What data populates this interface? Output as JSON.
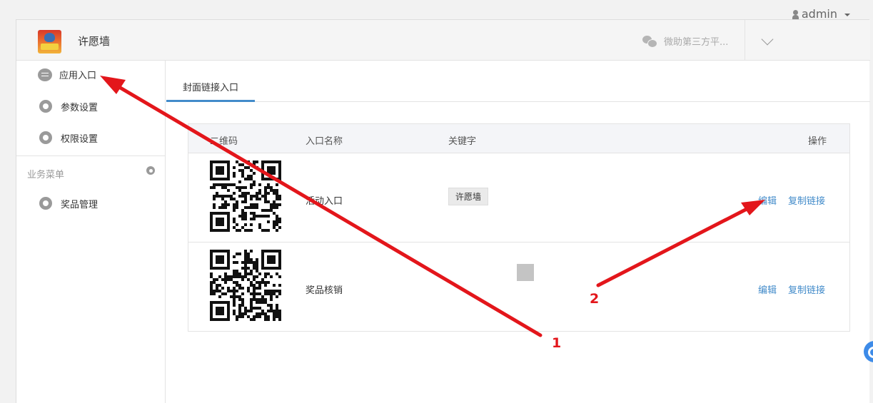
{
  "user": {
    "name": "admin"
  },
  "header": {
    "app_title": "许愿墙",
    "account_name": "微助第三方平..."
  },
  "sidebar": {
    "items": [
      {
        "label": "应用入口",
        "icon": "chat-bubble-icon"
      },
      {
        "label": "参数设置",
        "icon": "gear-icon"
      },
      {
        "label": "权限设置",
        "icon": "gear-icon"
      }
    ],
    "section_title": "业务菜单",
    "business_items": [
      {
        "label": "奖品管理",
        "icon": "gear-icon"
      }
    ]
  },
  "tabs": [
    {
      "label": "封面链接入口",
      "active": true
    }
  ],
  "table": {
    "headers": {
      "qr": "二维码",
      "name": "入口名称",
      "keyword": "关键字",
      "ops": "操作"
    },
    "rows": [
      {
        "name": "活动入口",
        "keyword": "许愿墙",
        "edit": "编辑",
        "copy": "复制链接"
      },
      {
        "name": "奖品核销",
        "keyword": "",
        "edit": "编辑",
        "copy": "复制链接"
      }
    ]
  },
  "annotations": [
    {
      "number": "1"
    },
    {
      "number": "2"
    }
  ],
  "colors": {
    "link": "#428bca",
    "annotation": "#e3161b",
    "tab_active": "#428bca"
  }
}
